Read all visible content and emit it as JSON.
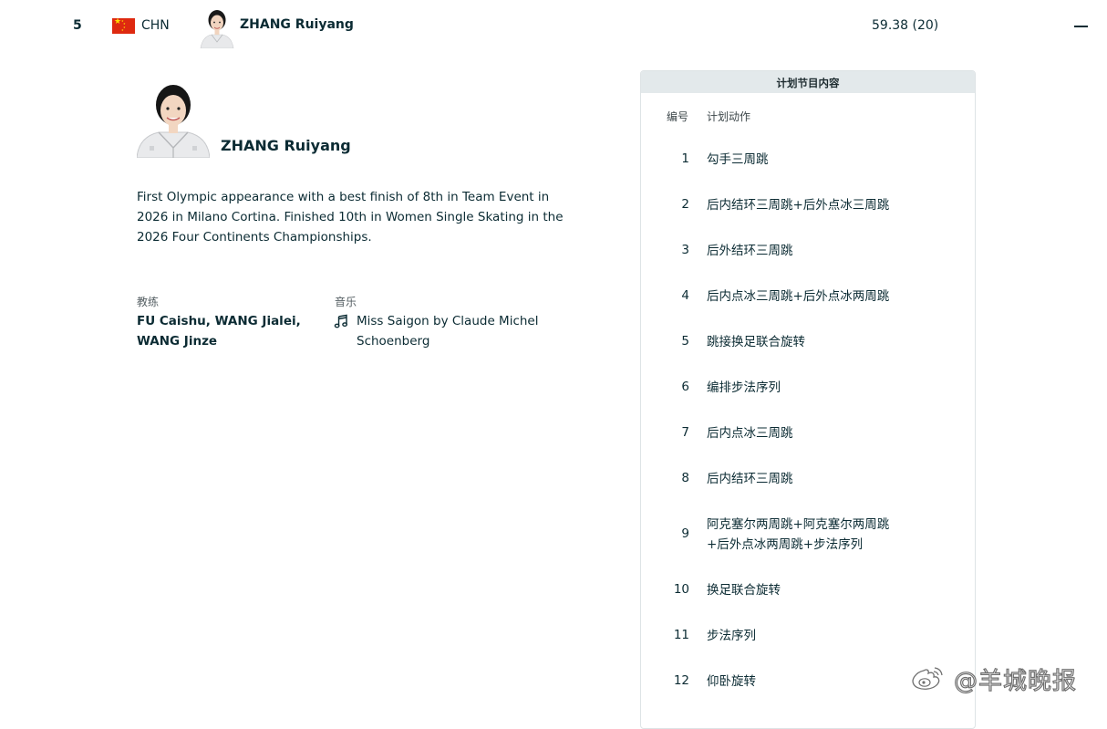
{
  "athlete_row": {
    "rank": "5",
    "country_code": "CHN",
    "name": "ZHANG Ruiyang",
    "score": "59.38 (20)"
  },
  "profile": {
    "name": "ZHANG Ruiyang",
    "bio": "First Olympic appearance with a best finish of 8th in Team Event in 2026 in Milano Cortina. Finished 10th in Women Single Skating in the 2026 Four Continents Championships.",
    "coach_label": "教练",
    "coach_value": "FU Caishu, WANG Jialei, WANG Jinze",
    "music_label": "音乐",
    "music_value": "Miss Saigon by Claude Michel Schoenberg"
  },
  "program_panel": {
    "title": "计划节目内容",
    "col_number": "编号",
    "col_element": "计划动作",
    "elements": [
      {
        "num": "1",
        "name": "勾手三周跳"
      },
      {
        "num": "2",
        "name": "后内结环三周跳+后外点冰三周跳"
      },
      {
        "num": "3",
        "name": "后外结环三周跳"
      },
      {
        "num": "4",
        "name": "后内点冰三周跳+后外点冰两周跳"
      },
      {
        "num": "5",
        "name": "跳接换足联合旋转"
      },
      {
        "num": "6",
        "name": "编排步法序列"
      },
      {
        "num": "7",
        "name": "后内点冰三周跳"
      },
      {
        "num": "8",
        "name": "后内结环三周跳"
      },
      {
        "num": "9",
        "name": "阿克塞尔两周跳+阿克塞尔两周跳+后外点冰两周跳+步法序列"
      },
      {
        "num": "10",
        "name": "换足联合旋转"
      },
      {
        "num": "11",
        "name": "步法序列"
      },
      {
        "num": "12",
        "name": "仰卧旋转"
      }
    ]
  },
  "watermark": {
    "text": "@羊城晚报"
  },
  "colors": {
    "text_primary": "#0b2b33",
    "panel_header_bg": "#e3e9eb",
    "panel_border": "#dde3e5",
    "flag_red": "#de2910",
    "flag_yellow": "#ffde00"
  },
  "icons": {
    "collapse": "minus-icon",
    "music": "music-note-icon",
    "flag": "china-flag-icon",
    "watermark_logo": "weibo-logo-icon"
  }
}
